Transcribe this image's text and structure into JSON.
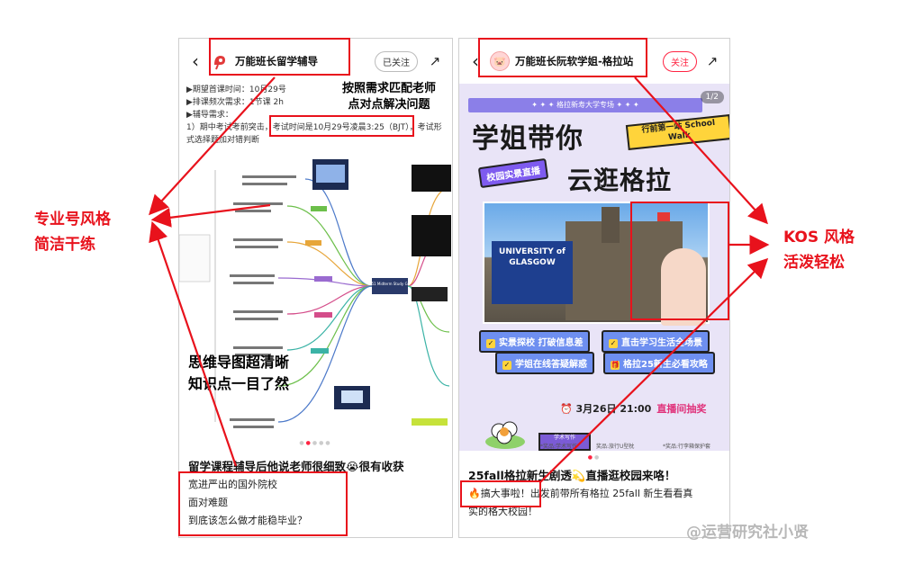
{
  "left_post": {
    "account": "万能班长留学辅导",
    "follow_label": "已关注",
    "requirements": [
      "▶期望首课时间：10月29号",
      "▶排课频次需求：1节课 2h",
      "▶辅导需求：",
      "1）期中考试考前突击，考试时间是10月29号凌晨3:25（BJT），考试形",
      "式选择题加对错判断"
    ],
    "overlay_title": [
      "按照需求匹配老师",
      "点对点解决问题"
    ],
    "mindmap_overlay": [
      "思维导图超清晰",
      "知识点一目了然"
    ],
    "mindmap_center": "ECS51 Midterm Study Guide",
    "post_title": "留学课程辅导后他说老师很细致😭很有收获",
    "post_lines": [
      "宽进严出的国外院校",
      "面对难题",
      "到底该怎么做才能稳毕业？"
    ]
  },
  "right_post": {
    "account": "万能班长阮软学姐-格拉站",
    "follow_label": "关注",
    "page_indicator": "1/2",
    "band": "✦ ✦ ✦  格拉新寿大学专场  ✦ ✦ ✦",
    "headline1": "学姐带你",
    "headline2": "云逛格拉",
    "tag_walk": "行前第一站 School Walk",
    "tag_live": "校园实景直播",
    "sign_text": "UNIVERSITY of GLASGOW",
    "features": [
      "实景探校 打破信息差",
      "直击学习生活全场景",
      "学姐在线答疑解惑",
      "格拉25新生必看攻略"
    ],
    "date_text": "⏰ 3月26日 21:00",
    "lottery": "直播间抽奖",
    "prize_captions": [
      "*奖品:学术写作",
      "奖品:旅行U型枕",
      "*奖品:行李箱保护套"
    ],
    "post_title": "25fall格拉新生剧透💫直播逛校园来咯！",
    "post_lines": [
      "🔥搞大事啦！出发前带所有格拉 25fall 新生看看真",
      "实的格大校园！"
    ]
  },
  "annotations": {
    "left": [
      "专业号风格",
      "简洁干练"
    ],
    "right": [
      "KOS 风格",
      "活泼轻松"
    ]
  },
  "watermark": "@运营研究社小贤",
  "colors": {
    "accent_red": "#e8121c",
    "brand_red": "#ff2442",
    "poster_bg": "#e9e4f7"
  }
}
